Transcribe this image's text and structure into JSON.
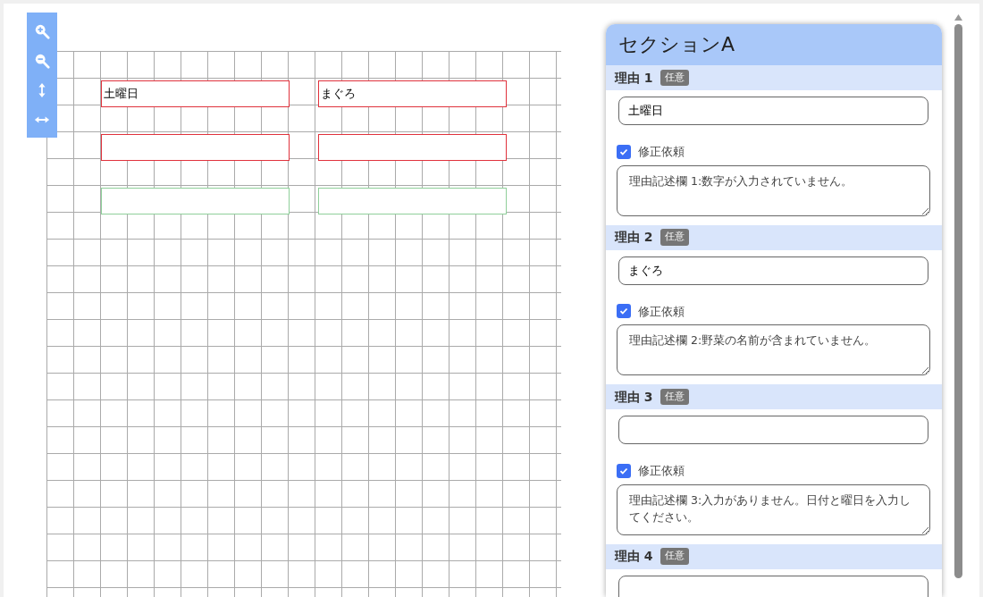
{
  "canvas": {
    "fields": [
      {
        "value": "土曜日",
        "invalid": true
      },
      {
        "value": "まぐろ",
        "invalid": true
      },
      {
        "invalid": true
      },
      {
        "invalid": true
      },
      {
        "invalid": false
      },
      {
        "invalid": false
      }
    ]
  },
  "panel": {
    "title": "セクションA",
    "reasons": [
      {
        "label": "理由 1",
        "badge": "任意",
        "value": "土曜日",
        "request": {
          "label": "修正依頼",
          "checked": true,
          "comment": "理由記述欄 1:数字が入力されていません。"
        }
      },
      {
        "label": "理由 2",
        "badge": "任意",
        "value": "まぐろ",
        "request": {
          "label": "修正依頼",
          "checked": true,
          "comment": "理由記述欄 2:野菜の名前が含まれていません。"
        }
      },
      {
        "label": "理由 3",
        "badge": "任意",
        "request": {
          "label": "修正依頼",
          "checked": true,
          "comment": "理由記述欄 3:入力がありません。日付と曜日を入力してください。"
        }
      },
      {
        "label": "理由 4",
        "badge": "任意"
      }
    ]
  }
}
